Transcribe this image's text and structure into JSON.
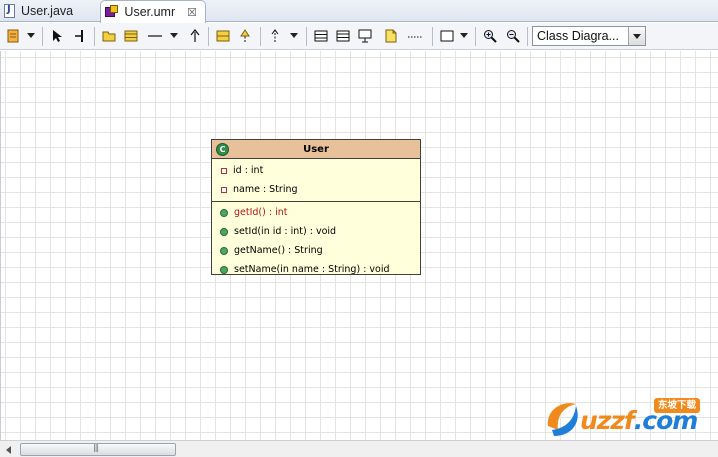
{
  "tabs": [
    {
      "label": "User.java",
      "icon": "java-file-icon",
      "active": false
    },
    {
      "label": "User.umr",
      "icon": "uml-model-icon",
      "active": true,
      "close": "☒"
    }
  ],
  "toolbar": {
    "diagram_type": "Class Diagra..."
  },
  "diagram": {
    "class_name": "User",
    "class_icon_letter": "C",
    "fields": [
      {
        "text": "id : int"
      },
      {
        "text": "name : String"
      }
    ],
    "methods": [
      {
        "text": "getId() : int",
        "highlighted": true
      },
      {
        "text": "setId(in id : int) : void",
        "highlighted": false
      },
      {
        "text": "getName() : String",
        "highlighted": false
      },
      {
        "text": "setName(in name : String) : void",
        "highlighted": false
      }
    ],
    "colors": {
      "header": "#e8c09a",
      "body": "#ffffdc",
      "highlight_text": "#b01818"
    }
  },
  "watermark": {
    "brand_main": "uzzf",
    "brand_suffix": ".com",
    "badge": "东坡下载"
  }
}
